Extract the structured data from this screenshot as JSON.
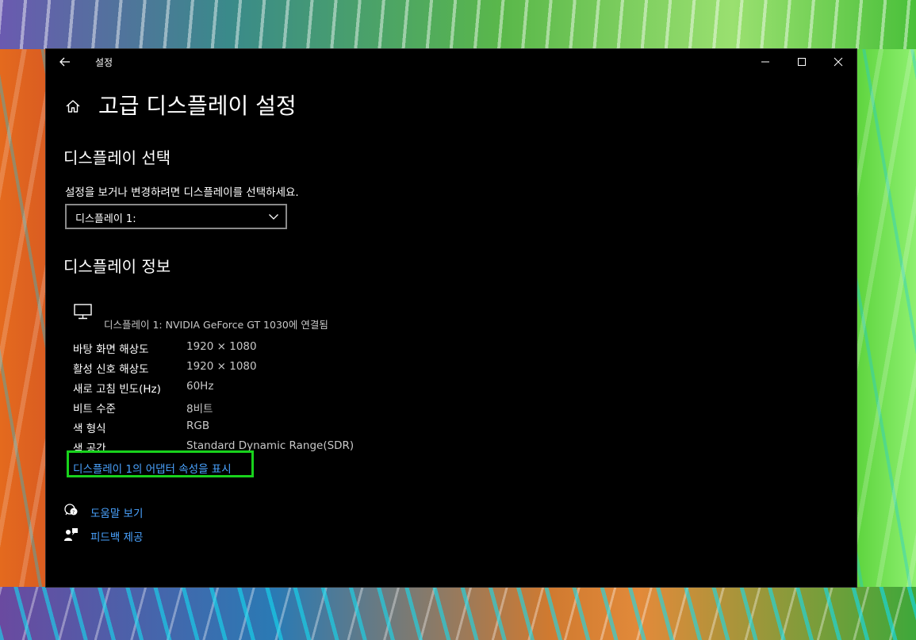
{
  "window": {
    "title": "설정",
    "controls": {
      "minimize_icon": "minimize-icon",
      "maximize_icon": "maximize-icon",
      "close_icon": "close-icon"
    }
  },
  "page": {
    "title": "고급 디스플레이 설정"
  },
  "select_display": {
    "heading": "디스플레이 선택",
    "description": "설정을 보거나 변경하려면 디스플레이를 선택하세요.",
    "selected": "디스플레이 1:"
  },
  "display_info": {
    "heading": "디스플레이 정보",
    "connected_caption": "디스플레이 1: NVIDIA GeForce GT 1030에 연결됨",
    "rows": [
      {
        "key": "바탕 화면 해상도",
        "value": "1920 × 1080"
      },
      {
        "key": "활성 신호 해상도",
        "value": "1920 × 1080"
      },
      {
        "key": "새로 고침 빈도(Hz)",
        "value": "60Hz"
      },
      {
        "key": "비트 수준",
        "value": "8비트"
      },
      {
        "key": "색 형식",
        "value": "RGB"
      },
      {
        "key": "색 공간",
        "value": "Standard Dynamic Range(SDR)"
      }
    ],
    "adapter_link": "디스플레이 1의 어댑터 속성을 표시"
  },
  "help": {
    "get_help": "도움말 보기",
    "feedback": "피드백 제공"
  },
  "colors": {
    "window_bg": "#000000",
    "link": "#4aa3ff",
    "highlight_box": "#18d21c",
    "secondary_text": "#c8c8c8"
  }
}
